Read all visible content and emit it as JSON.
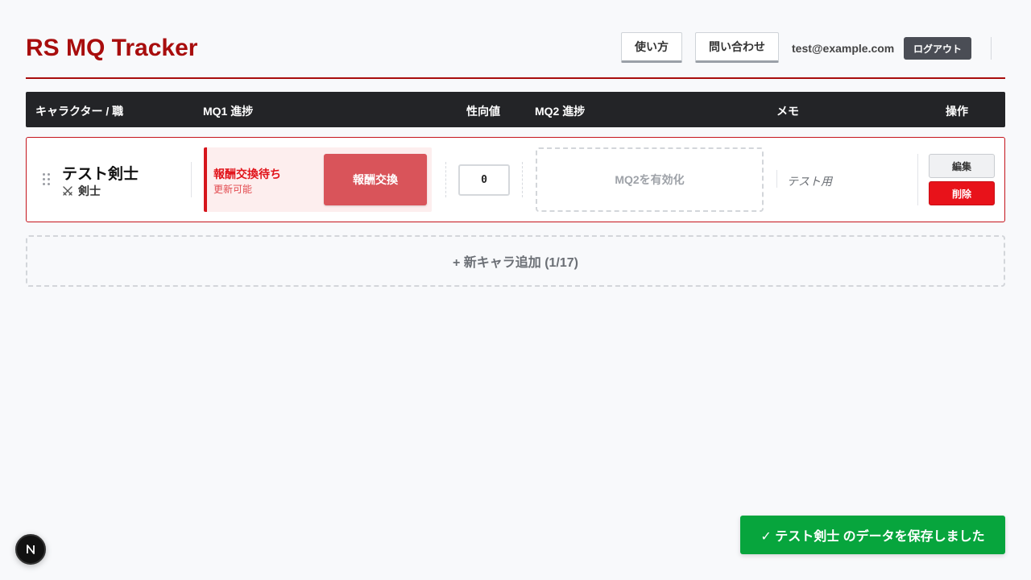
{
  "header": {
    "title": "RS MQ Tracker",
    "howto_label": "使い方",
    "contact_label": "問い合わせ",
    "user_email": "test@example.com",
    "logout_label": "ログアウト"
  },
  "table": {
    "columns": [
      "キャラクター / 職",
      "MQ1 進捗",
      "性向値",
      "MQ2 進捗",
      "メモ",
      "操作"
    ]
  },
  "rows": [
    {
      "name": "テスト剣士",
      "class_icon": "crossed-swords-icon",
      "class_label": "剣士",
      "mq1_status": "報酬交換待ち",
      "mq1_sub": "更新可能",
      "mq1_action_label": "報酬交換",
      "alignment_value": "0",
      "mq2_enable_label": "MQ2を有効化",
      "memo": "テスト用",
      "edit_label": "編集",
      "delete_label": "削除"
    }
  ],
  "add_character_label": "+ 新キャラ追加 (1/17)",
  "toast": {
    "message": "✓ テスト剣士 のデータを保存しました"
  },
  "colors": {
    "brand": "#a80d0d",
    "danger": "#e8121a",
    "success": "#07a53d",
    "header_bg": "#232427"
  }
}
